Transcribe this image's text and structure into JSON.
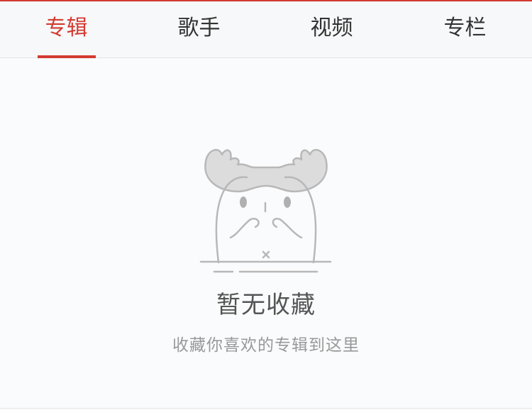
{
  "tabs": [
    {
      "label": "专辑",
      "active": true
    },
    {
      "label": "歌手",
      "active": false
    },
    {
      "label": "视频",
      "active": false
    },
    {
      "label": "专栏",
      "active": false
    }
  ],
  "empty_state": {
    "icon": "moose-mascot-icon",
    "title": "暂无收藏",
    "subtitle": "收藏你喜欢的专辑到这里"
  },
  "colors": {
    "accent": "#d33a31",
    "text_primary": "#333333",
    "text_secondary": "#999999",
    "background": "#fafbfc"
  }
}
